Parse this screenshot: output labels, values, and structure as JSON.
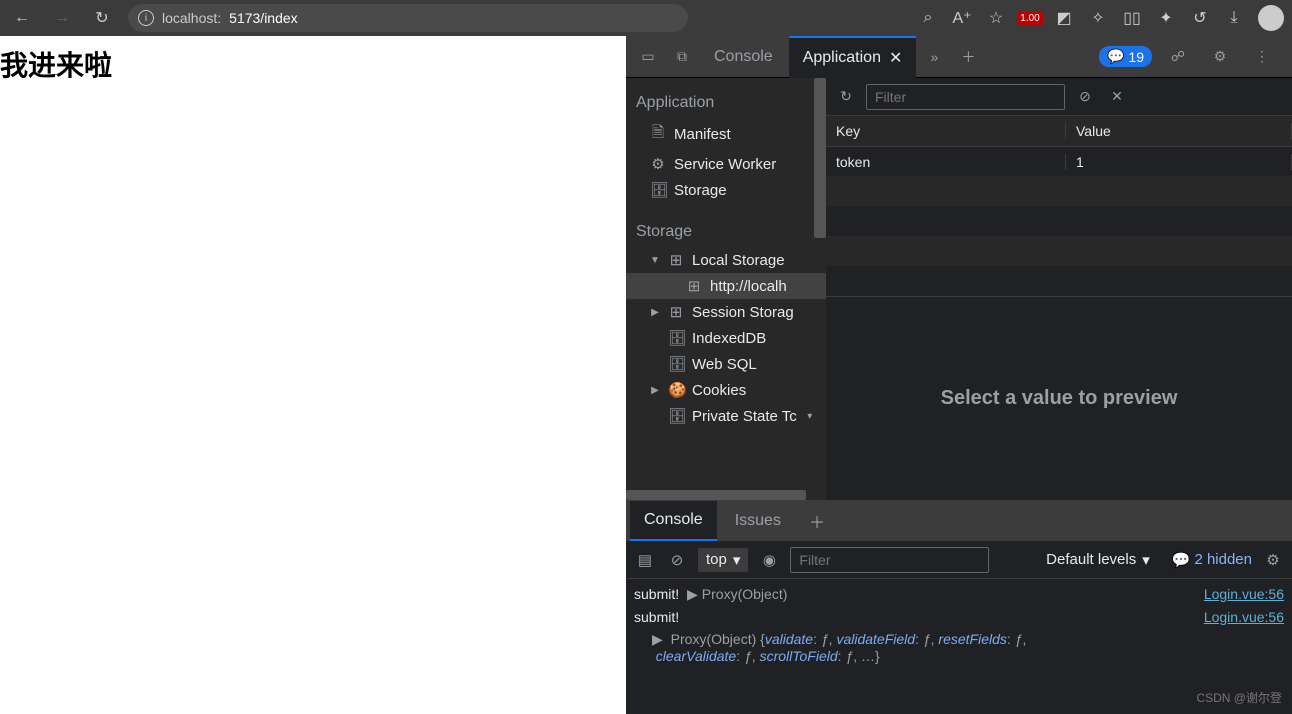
{
  "browser": {
    "url_host": "localhost:",
    "url_port_path": "5173/index",
    "badge_text": "1.00"
  },
  "page": {
    "heading": "我进来啦"
  },
  "devtools": {
    "tabs": {
      "console": "Console",
      "application": "Application"
    },
    "issues_count": "19",
    "sidebar": {
      "app_section": "Application",
      "items_app": [
        "Manifest",
        "Service Worker",
        "Storage"
      ],
      "storage_section": "Storage",
      "local_storage": "Local Storage",
      "local_storage_origin": "http://localh",
      "session_storage": "Session Storag",
      "indexeddb": "IndexedDB",
      "websql": "Web SQL",
      "cookies": "Cookies",
      "private_state": "Private State Tc"
    },
    "storage": {
      "filter_placeholder": "Filter",
      "col_key": "Key",
      "col_value": "Value",
      "rows": [
        {
          "key": "token",
          "value": "1"
        }
      ],
      "preview_msg": "Select a value to preview"
    }
  },
  "drawer": {
    "tabs": {
      "console": "Console",
      "issues": "Issues"
    },
    "context": "top",
    "filter_placeholder": "Filter",
    "levels_label": "Default levels",
    "hidden_label": "2 hidden",
    "logs": {
      "line1_msg": "submit!",
      "line1_proxy": "Proxy(Object)",
      "line1_src": "Login.vue:56",
      "line2_msg": "submit!",
      "line2_src": "Login.vue:56",
      "line3_prefix": "Proxy(Object) {",
      "k1": "validate",
      "k2": "validateField",
      "k3": "resetFields",
      "k4": "clearValidate",
      "k5": "scrollToField",
      "fn": "ƒ",
      "suffix": ", …}"
    }
  },
  "watermark": "CSDN @谢尔登"
}
